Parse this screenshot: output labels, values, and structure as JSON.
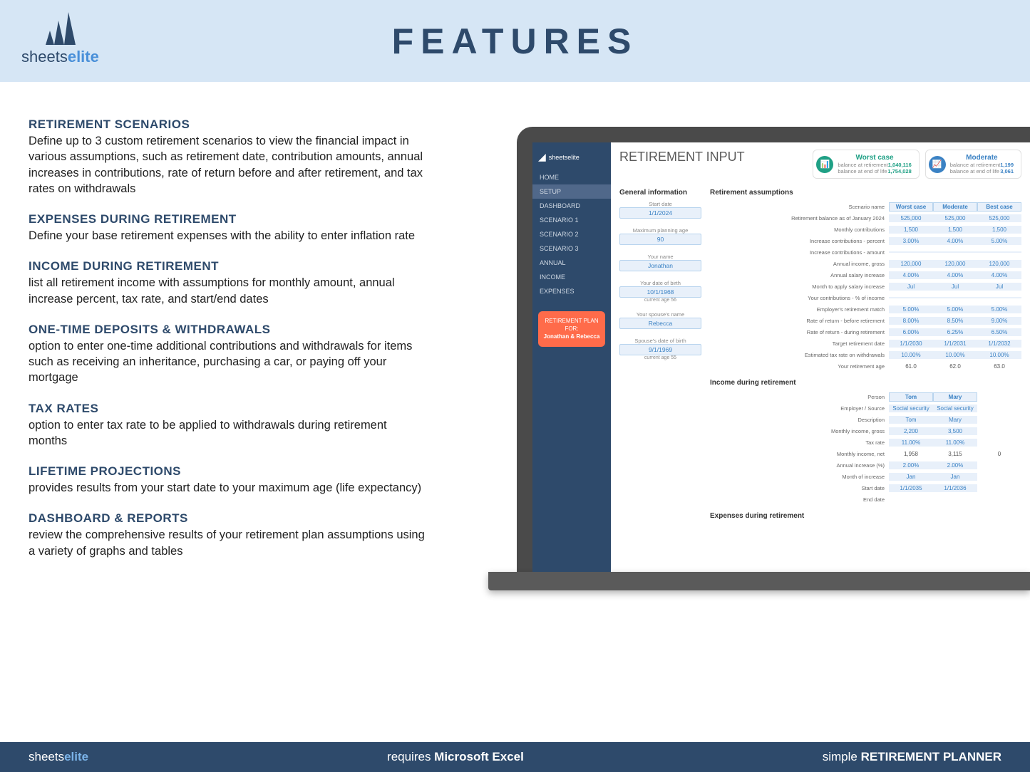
{
  "header": {
    "title": "FEATURES",
    "logo_1": "sheets",
    "logo_2": "elite"
  },
  "features": [
    {
      "title": "RETIREMENT SCENARIOS",
      "body": "Define up to 3 custom retirement scenarios to view the financial impact in various assumptions, such as retirement date, contribution amounts, annual increases in contributions, rate of return before and after retirement, and tax rates on withdrawals"
    },
    {
      "title": "EXPENSES DURING RETIREMENT",
      "body": "Define your base retirement expenses with the ability to enter inflation rate"
    },
    {
      "title": "INCOME DURING RETIREMENT",
      "body": "list all retirement income with assumptions for monthly amount, annual increase percent, tax rate, and start/end dates"
    },
    {
      "title": "ONE-TIME DEPOSITS & WITHDRAWALS",
      "body": "option to enter one-time additional contributions and withdrawals for items such as receiving an inheritance, purchasing a car, or paying off your mortgage"
    },
    {
      "title": "TAX RATES",
      "body": "option to enter tax rate to be applied to withdrawals during retirement months"
    },
    {
      "title": "LIFETIME PROJECTIONS",
      "body": "provides results from your start date to your maximum age (life expectancy)"
    },
    {
      "title": "DASHBOARD & REPORTS",
      "body": "review the comprehensive results of your retirement plan assumptions using a variety of graphs and tables"
    }
  ],
  "sidebar": {
    "brand": "sheetselite",
    "items": [
      "HOME",
      "SETUP",
      "DASHBOARD",
      "SCENARIO 1",
      "SCENARIO 2",
      "SCENARIO 3",
      "ANNUAL",
      "INCOME",
      "EXPENSES"
    ],
    "active_index": 1,
    "badge_l1": "RETIREMENT PLAN FOR:",
    "badge_l2": "Jonathan & Rebecca"
  },
  "app": {
    "title": "RETIREMENT INPUT",
    "cards": [
      {
        "name": "Worst case",
        "b1_label": "balance at retirement",
        "b1_val": "1,040,116",
        "b2_label": "balance at end of life",
        "b2_val": "1,754,028",
        "color": "#1fa085"
      },
      {
        "name": "Moderate",
        "b1_label": "balance at retirement",
        "b1_val": "1,199",
        "b2_label": "balance at end of life",
        "b2_val": "3,061",
        "color": "#3b82c4"
      }
    ],
    "general_info_title": "General information",
    "gi": [
      {
        "label": "Start date",
        "val": "1/1/2024"
      },
      {
        "label": "Maximum planning age",
        "val": "90",
        "note": ""
      },
      {
        "label": "Your name",
        "val": "Jonathan"
      },
      {
        "label": "Your date of birth",
        "val": "10/1/1968",
        "note": "current age 56"
      },
      {
        "label": "Your spouse's name",
        "val": "Rebecca"
      },
      {
        "label": "Spouse's date of birth",
        "val": "9/1/1969",
        "note": "current age 55"
      }
    ],
    "assumptions_title": "Retirement assumptions",
    "assumption_headers": [
      "Worst case",
      "Moderate",
      "Best case"
    ],
    "assumptions": [
      {
        "lbl": "Retirement balance as of January 2024",
        "v": [
          "525,000",
          "525,000",
          "525,000"
        ]
      },
      {
        "lbl": "Monthly contributions",
        "v": [
          "1,500",
          "1,500",
          "1,500"
        ]
      },
      {
        "lbl": "Increase contributions - percent",
        "v": [
          "3.00%",
          "4.00%",
          "5.00%"
        ]
      },
      {
        "lbl": "Increase contributions - amount",
        "v": [
          "",
          "",
          ""
        ]
      },
      {
        "lbl": "Annual income, gross",
        "v": [
          "120,000",
          "120,000",
          "120,000"
        ]
      },
      {
        "lbl": "Annual salary increase",
        "v": [
          "4.00%",
          "4.00%",
          "4.00%"
        ]
      },
      {
        "lbl": "Month to apply salary increase",
        "v": [
          "Jul",
          "Jul",
          "Jul"
        ]
      },
      {
        "lbl": "Your contributions - % of income",
        "v": [
          "",
          "",
          ""
        ]
      },
      {
        "lbl": "Employer's retirement match",
        "v": [
          "5.00%",
          "5.00%",
          "5.00%"
        ]
      },
      {
        "lbl": "Rate of return - before retirement",
        "v": [
          "8.00%",
          "8.50%",
          "9.00%"
        ]
      },
      {
        "lbl": "Rate of return - during retirement",
        "v": [
          "6.00%",
          "6.25%",
          "6.50%"
        ]
      },
      {
        "lbl": "Target retirement date",
        "v": [
          "1/1/2030",
          "1/1/2031",
          "1/1/2032"
        ]
      },
      {
        "lbl": "Estimated tax rate on withdrawals",
        "v": [
          "10.00%",
          "10.00%",
          "10.00%"
        ]
      },
      {
        "lbl": "Your retirement age",
        "v": [
          "61.0",
          "62.0",
          "63.0"
        ],
        "plain": true
      }
    ],
    "income_title": "Income during retirement",
    "income_headers": [
      "Tom",
      "Mary"
    ],
    "income_rows": [
      {
        "lbl": "Employer / Source",
        "v": [
          "Social security",
          "Social security",
          ""
        ]
      },
      {
        "lbl": "Description",
        "v": [
          "Tom",
          "Mary",
          ""
        ]
      },
      {
        "lbl": "Monthly income, gross",
        "v": [
          "2,200",
          "3,500",
          ""
        ]
      },
      {
        "lbl": "Tax rate",
        "v": [
          "11.00%",
          "11.00%",
          ""
        ]
      },
      {
        "lbl": "Monthly income, net",
        "v": [
          "1,958",
          "3,115",
          "0"
        ],
        "plain": true
      },
      {
        "lbl": "Annual increase (%)",
        "v": [
          "2.00%",
          "2.00%",
          ""
        ]
      },
      {
        "lbl": "Month of increase",
        "v": [
          "Jan",
          "Jan",
          ""
        ]
      },
      {
        "lbl": "Start date",
        "v": [
          "1/1/2035",
          "1/1/2036",
          ""
        ]
      },
      {
        "lbl": "End date",
        "v": [
          "",
          "",
          ""
        ]
      }
    ],
    "expenses_title": "Expenses during retirement"
  },
  "footer": {
    "left_1": "sheets",
    "left_2": "elite",
    "center_1": "requires ",
    "center_2": "Microsoft Excel",
    "right_1": "simple ",
    "right_2": "RETIREMENT PLANNER"
  }
}
